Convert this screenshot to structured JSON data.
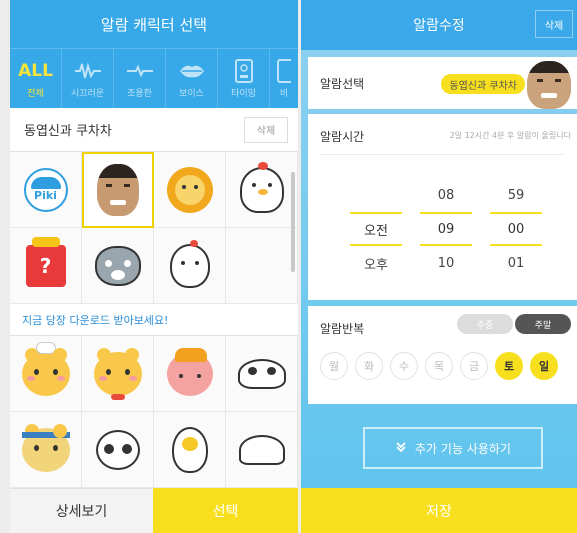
{
  "left": {
    "title": "알람 캐릭터 선택",
    "tabs": [
      {
        "icon_text": "ALL",
        "label": "전체",
        "active": true
      },
      {
        "icon": "waveform-icon",
        "label": "시끄러운"
      },
      {
        "icon": "pulse-icon",
        "label": "조용한"
      },
      {
        "icon": "lips-icon",
        "label": "보이스"
      },
      {
        "icon": "tablet-icon",
        "label": "타이밍"
      },
      {
        "icon": "device-icon",
        "label": "비"
      }
    ],
    "selected_name": "동엽신과 쿠차차",
    "delete_label": "삭제",
    "grid1": [
      "piki-logo",
      "celebrity-face",
      "lion-mascot",
      "white-bird",
      "gift-box",
      "gray-cat",
      "white-chick",
      ""
    ],
    "piki_text": "Piki",
    "download_text": "지금 당장 다운로드 받아보세요!",
    "grid2": [
      "chef-bear",
      "bowtie-bear",
      "pink-bear-hat",
      "panda-lying",
      "headband-bear",
      "crying-panda",
      "egg-character",
      "white-blob"
    ],
    "detail_label": "상세보기",
    "select_label": "선택"
  },
  "right": {
    "title": "알람수정",
    "delete_label": "삭제",
    "alarm_select_label": "알람선택",
    "alarm_select_value": "동엽신과 쿠차차",
    "alarm_time_label": "알람시간",
    "alarm_time_note": "2일 12시간 4분 후 알람이 울립니다",
    "ampm": [
      "오전",
      "오후"
    ],
    "hours": [
      "08",
      "09",
      "10"
    ],
    "minutes": [
      "59",
      "00",
      "01"
    ],
    "repeat_label": "알람반복",
    "weekday_pill": "주중",
    "weekend_pill": "주말",
    "days": [
      {
        "label": "월",
        "on": false
      },
      {
        "label": "화",
        "on": false
      },
      {
        "label": "수",
        "on": false
      },
      {
        "label": "목",
        "on": false
      },
      {
        "label": "금",
        "on": false
      },
      {
        "label": "토",
        "on": true
      },
      {
        "label": "일",
        "on": true
      }
    ],
    "more_label": "추가 기능 사용하기",
    "save_label": "저장"
  },
  "colors": {
    "accent_blue": "#3ba9e9",
    "accent_yellow": "#f7df1e"
  }
}
